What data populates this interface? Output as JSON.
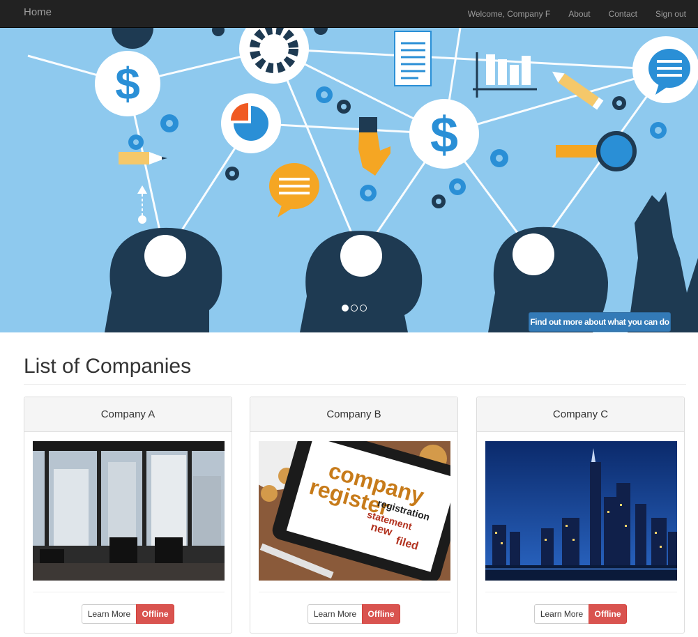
{
  "navbar": {
    "brand": "Home",
    "links": [
      "Welcome, Company F",
      "About",
      "Contact",
      "Sign out"
    ]
  },
  "carousel": {
    "cta_label": "Find out more about what you can do",
    "slide_count": 3,
    "active_slide": 1
  },
  "main": {
    "title": "List of Companies",
    "companies": [
      {
        "name": "Company A",
        "learn_more": "Learn More",
        "status": "Offline"
      },
      {
        "name": "Company B",
        "learn_more": "Learn More",
        "status": "Offline"
      },
      {
        "name": "Company C",
        "learn_more": "Learn More",
        "status": "Offline"
      }
    ],
    "image_words": {
      "company": "company",
      "register": "register",
      "registration": "registration",
      "statement": "statement",
      "new": "new",
      "filed": "filed"
    }
  },
  "colors": {
    "navbar_bg": "#222222",
    "carousel_bg": "#8ec9ee",
    "primary": "#337ab7",
    "danger": "#d9534f"
  }
}
